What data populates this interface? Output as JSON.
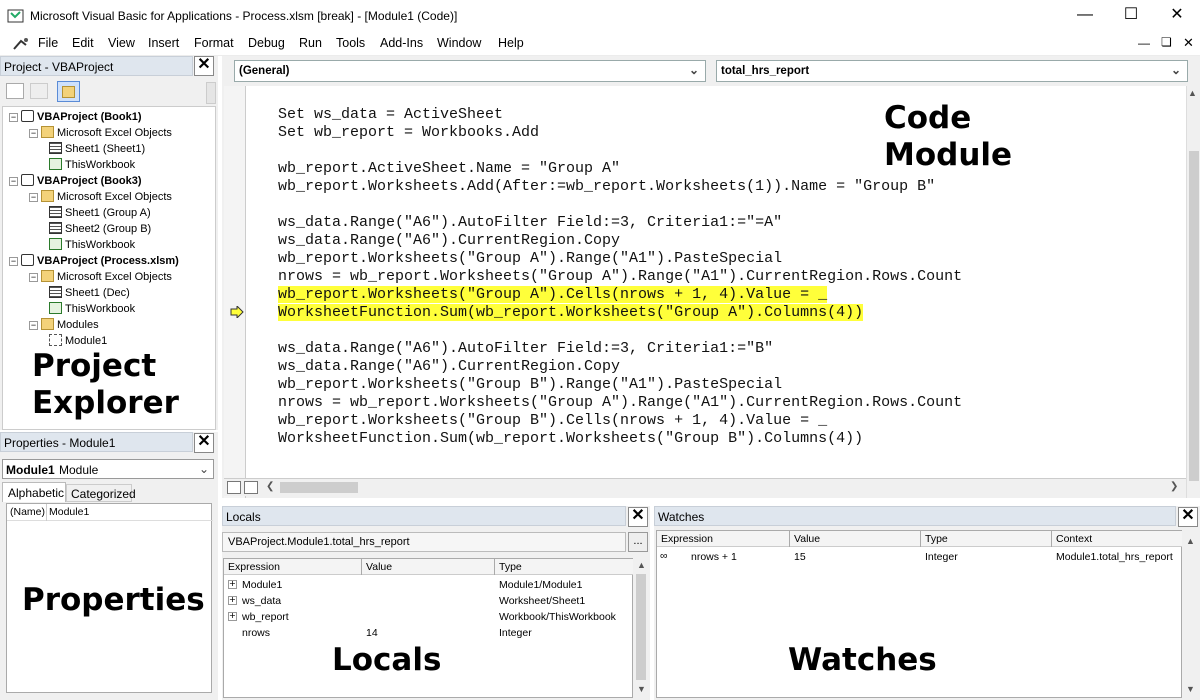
{
  "window": {
    "title": "Microsoft Visual Basic for Applications - Process.xlsm [break] - [Module1 (Code)]"
  },
  "menu": [
    "File",
    "Edit",
    "View",
    "Insert",
    "Format",
    "Debug",
    "Run",
    "Tools",
    "Add-Ins",
    "Window",
    "Help"
  ],
  "project": {
    "title": "Project - VBAProject",
    "tree": [
      {
        "text": "VBAProject (Book1)",
        "level": 0,
        "kind": "project",
        "bold": true
      },
      {
        "text": "Microsoft Excel Objects",
        "level": 1,
        "kind": "folder"
      },
      {
        "text": "Sheet1 (Sheet1)",
        "level": 2,
        "kind": "sheet"
      },
      {
        "text": "ThisWorkbook",
        "level": 2,
        "kind": "workbook"
      },
      {
        "text": "VBAProject (Book3)",
        "level": 0,
        "kind": "project",
        "bold": true
      },
      {
        "text": "Microsoft Excel Objects",
        "level": 1,
        "kind": "folder"
      },
      {
        "text": "Sheet1 (Group A)",
        "level": 2,
        "kind": "sheet"
      },
      {
        "text": "Sheet2 (Group B)",
        "level": 2,
        "kind": "sheet"
      },
      {
        "text": "ThisWorkbook",
        "level": 2,
        "kind": "workbook"
      },
      {
        "text": "VBAProject (Process.xlsm)",
        "level": 0,
        "kind": "project",
        "bold": true
      },
      {
        "text": "Microsoft Excel Objects",
        "level": 1,
        "kind": "folder"
      },
      {
        "text": "Sheet1 (Dec)",
        "level": 2,
        "kind": "sheet"
      },
      {
        "text": "ThisWorkbook",
        "level": 2,
        "kind": "workbook"
      },
      {
        "text": "Modules",
        "level": 1,
        "kind": "folder"
      },
      {
        "text": "Module1",
        "level": 2,
        "kind": "module"
      }
    ],
    "callout": [
      "Project",
      "Explorer"
    ]
  },
  "properties": {
    "title": "Properties - Module1",
    "object_name": "Module1",
    "object_type": "Module",
    "tabs": [
      "Alphabetic",
      "Categorized"
    ],
    "row_name": "(Name)",
    "row_value": "Module1",
    "callout": "Properties"
  },
  "code": {
    "general": "(General)",
    "procedure": "total_hrs_report",
    "lines": [
      "Set ws_data = ActiveSheet",
      "Set wb_report = Workbooks.Add",
      "",
      "wb_report.ActiveSheet.Name = \"Group A\"",
      "wb_report.Worksheets.Add(After:=wb_report.Worksheets(1)).Name = \"Group B\"",
      "",
      "ws_data.Range(\"A6\").AutoFilter Field:=3, Criteria1:=\"=A\"",
      "ws_data.Range(\"A6\").CurrentRegion.Copy",
      "wb_report.Worksheets(\"Group A\").Range(\"A1\").PasteSpecial",
      "nrows = wb_report.Worksheets(\"Group A\").Range(\"A1\").CurrentRegion.Rows.Count",
      "wb_report.Worksheets(\"Group A\").Cells(nrows + 1, 4).Value = _",
      "WorksheetFunction.Sum(wb_report.Worksheets(\"Group A\").Columns(4))",
      "",
      "ws_data.Range(\"A6\").AutoFilter Field:=3, Criteria1:=\"B\"",
      "ws_data.Range(\"A6\").CurrentRegion.Copy",
      "wb_report.Worksheets(\"Group B\").Range(\"A1\").PasteSpecial",
      "nrows = wb_report.Worksheets(\"Group A\").Range(\"A1\").CurrentRegion.Rows.Count",
      "wb_report.Worksheets(\"Group B\").Cells(nrows + 1, 4).Value = _",
      "WorksheetFunction.Sum(wb_report.Worksheets(\"Group B\").Columns(4))"
    ],
    "highlighted_lines": [
      10,
      11
    ],
    "callout": [
      "Code",
      "Module"
    ]
  },
  "locals": {
    "title": "Locals",
    "context": "VBAProject.Module1.total_hrs_report",
    "context_button": "...",
    "headers": [
      "Expression",
      "Value",
      "Type"
    ],
    "rows": [
      {
        "expr": "Module1",
        "value": "",
        "type": "Module1/Module1",
        "expandable": true
      },
      {
        "expr": "ws_data",
        "value": "",
        "type": "Worksheet/Sheet1",
        "expandable": true
      },
      {
        "expr": "wb_report",
        "value": "",
        "type": "Workbook/ThisWorkbook",
        "expandable": true
      },
      {
        "expr": "nrows",
        "value": "14",
        "type": "Integer",
        "expandable": false
      }
    ],
    "callout": "Locals"
  },
  "watches": {
    "title": "Watches",
    "headers": [
      "Expression",
      "Value",
      "Type",
      "Context"
    ],
    "rows": [
      {
        "expr": "nrows + 1",
        "value": "15",
        "type": "Integer",
        "context": "Module1.total_hrs_report"
      }
    ],
    "callout": "Watches"
  }
}
